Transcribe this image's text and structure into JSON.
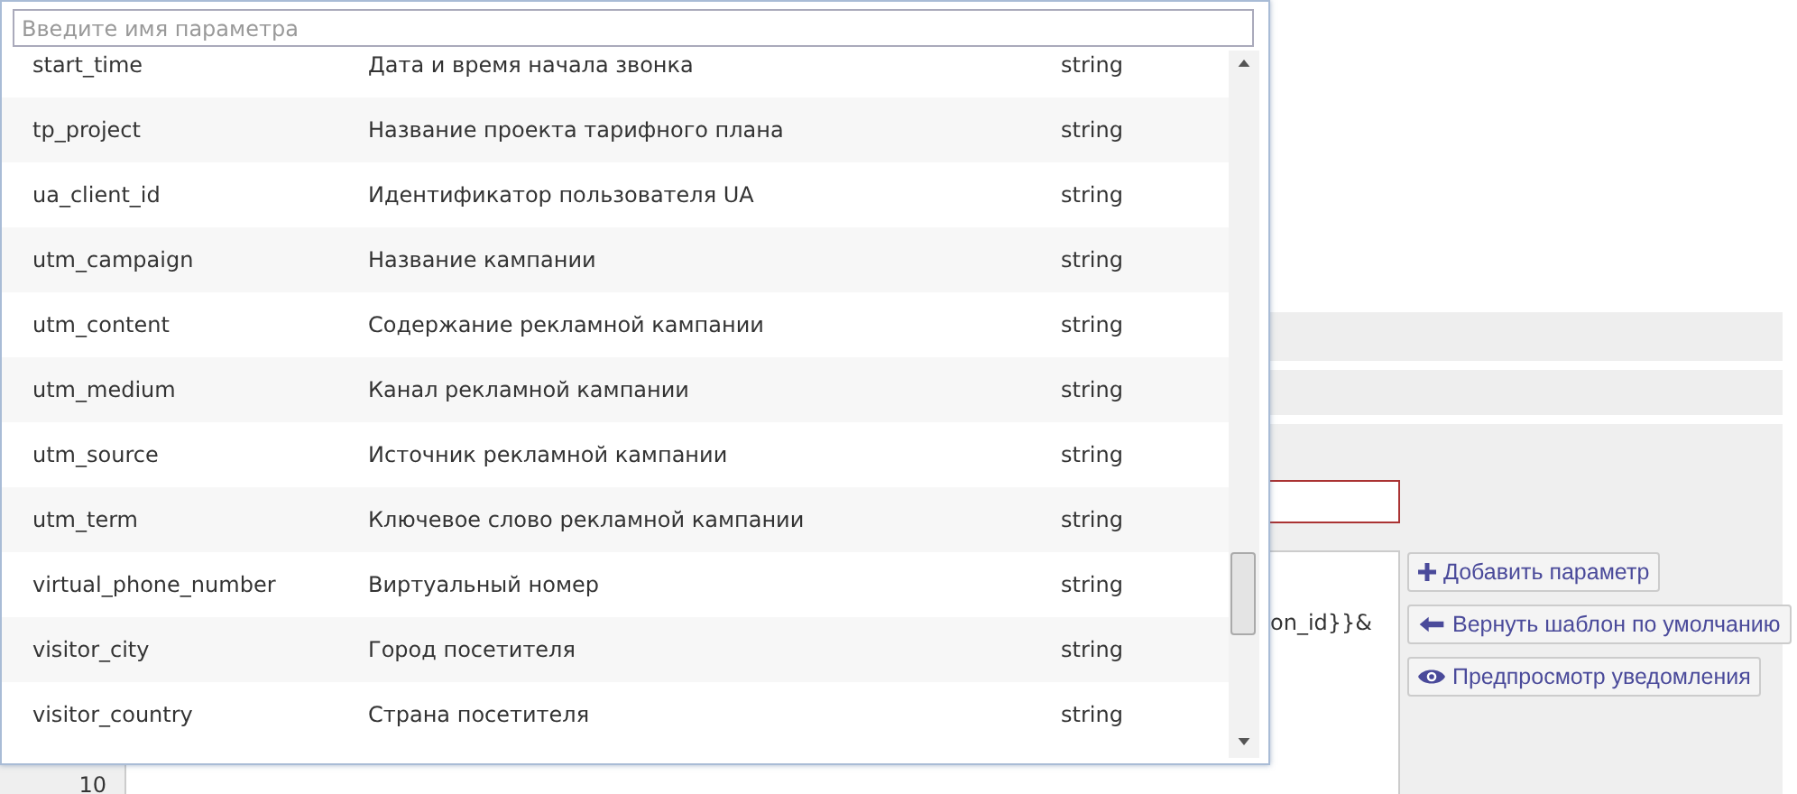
{
  "parameter_picker": {
    "search": {
      "placeholder": "Введите имя параметра"
    },
    "rows": [
      {
        "name": "start_time",
        "description": "Дата и время начала звонка",
        "type": "string"
      },
      {
        "name": "tp_project",
        "description": "Название проекта тарифного плана",
        "type": "string"
      },
      {
        "name": "ua_client_id",
        "description": "Идентификатор пользователя UA",
        "type": "string"
      },
      {
        "name": "utm_campaign",
        "description": "Название кампании",
        "type": "string"
      },
      {
        "name": "utm_content",
        "description": "Содержание рекламной кампании",
        "type": "string"
      },
      {
        "name": "utm_medium",
        "description": "Канал рекламной кампании",
        "type": "string"
      },
      {
        "name": "utm_source",
        "description": "Источник рекламной кампании",
        "type": "string"
      },
      {
        "name": "utm_term",
        "description": "Ключевое слово рекламной кампании",
        "type": "string"
      },
      {
        "name": "virtual_phone_number",
        "description": "Виртуальный номер",
        "type": "string"
      },
      {
        "name": "visitor_city",
        "description": "Город посетителя",
        "type": "string"
      },
      {
        "name": "visitor_country",
        "description": "Страна посетителя",
        "type": "string"
      }
    ]
  },
  "editor": {
    "line_number": "10",
    "text": "on_id}}&"
  },
  "buttons": [
    {
      "kind": "add",
      "label": "Добавить параметр"
    },
    {
      "kind": "reset",
      "label": "Вернуть шаблон по умолчанию"
    },
    {
      "kind": "preview",
      "label": "Предпросмотр уведомления"
    }
  ]
}
